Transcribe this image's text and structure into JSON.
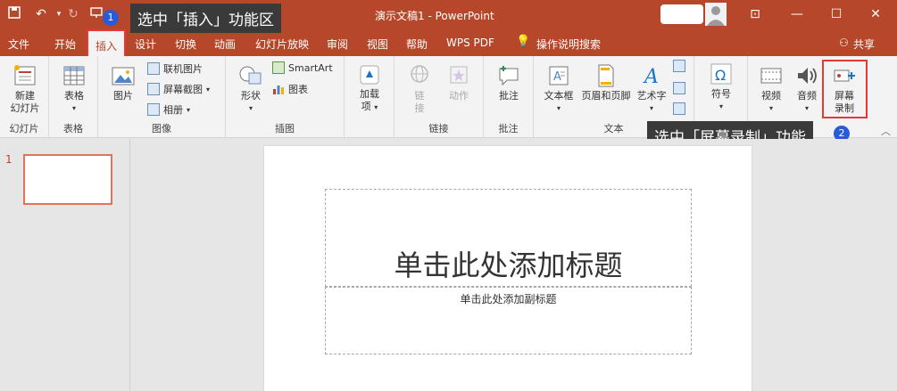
{
  "window": {
    "title": "演示文稿1  -  PowerPoint",
    "minimize_glyph": "—",
    "maximize_glyph": "☐",
    "close_glyph": "✕",
    "ribbon_display_glyph": "⊡"
  },
  "quick_access": {
    "save_icon": "save-icon",
    "undo_icon": "undo-icon",
    "redo_icon": "redo-icon",
    "present_icon": "present-icon"
  },
  "menu": {
    "items": [
      "文件",
      "开始",
      "插入",
      "设计",
      "切换",
      "动画",
      "幻灯片放映",
      "审阅",
      "视图",
      "帮助",
      "WPS PDF"
    ],
    "active": "插入",
    "search_label": "操作说明搜索",
    "share_label": "共享"
  },
  "ribbon": {
    "new_slide": "新建\n幻灯片",
    "table": "表格",
    "image": "图片",
    "online_image": "联机图片",
    "screenshot": "屏幕截图",
    "album": "相册",
    "shapes": "形状",
    "smartart": "SmartArt",
    "chart": "图表",
    "addins": "加载\n项",
    "link": "链\n接",
    "action": "动作",
    "comment": "批注",
    "textbox": "文本框",
    "header_footer": "页眉和页脚",
    "wordart": "艺术字",
    "symbol": "符号",
    "video": "视频",
    "audio": "音频",
    "screen_record": "屏幕\n录制",
    "groups": {
      "slides": "幻灯片",
      "tables": "表格",
      "images": "图像",
      "illustrations": "插图",
      "links": "链接",
      "comments": "批注",
      "text": "文本"
    }
  },
  "callouts": {
    "step1": {
      "badge": "1",
      "text": "选中「插入」功能区"
    },
    "step2": {
      "badge": "2",
      "text": "选中「屏幕录制」功能"
    }
  },
  "slides_pane": {
    "slide_number": "1"
  },
  "slide": {
    "title_placeholder": "单击此处添加标题",
    "subtitle_placeholder": "单击此处添加副标题"
  },
  "colors": {
    "accent": "#b7472a",
    "highlight": "#e53935",
    "badge": "#2a5bd7",
    "callout_bg": "#3a3a3a"
  }
}
